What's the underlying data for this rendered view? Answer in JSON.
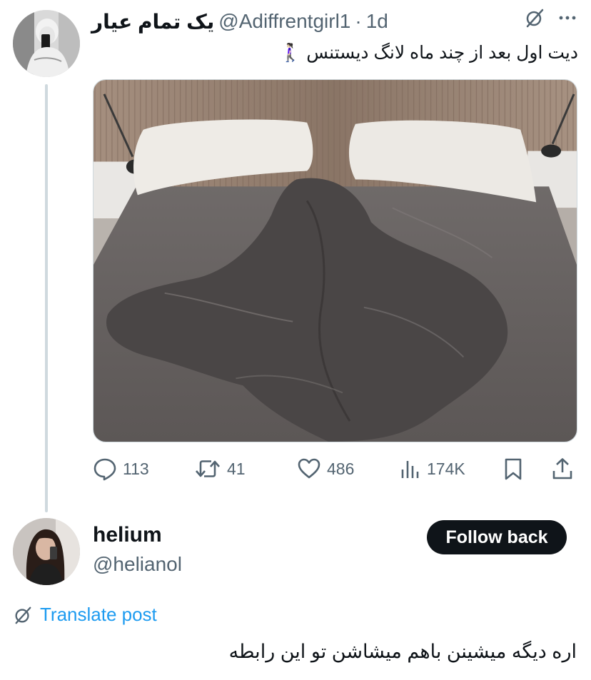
{
  "tweet": {
    "display_name": "یک تمام عیار",
    "handle": "@Adiffrentgirl1",
    "separator": "·",
    "age": "1d",
    "text": "دیت اول بعد از چند ماه لانگ دیستنس 🚶🏻‍♀️",
    "header_icons": [
      "grok-icon",
      "more-icon"
    ],
    "media_alt": "bed-photo",
    "stats": {
      "replies": "113",
      "reposts": "41",
      "likes": "486",
      "views": "174K"
    },
    "action_icons": [
      "reply-icon",
      "repost-icon",
      "like-icon",
      "views-icon",
      "bookmark-icon",
      "share-icon"
    ]
  },
  "reply": {
    "display_name": "helium",
    "handle": "@helianol",
    "follow_label": "Follow back",
    "translate_label": "Translate post",
    "translate_icon": "grok-icon",
    "text": "اره دیگه میشینن باهم میشاشن تو این رابطه"
  },
  "colors": {
    "text": "#0f1419",
    "secondary": "#536471",
    "link": "#1d9bf0",
    "thread_line": "#cfd9de",
    "follow_bg": "#0f1419"
  }
}
